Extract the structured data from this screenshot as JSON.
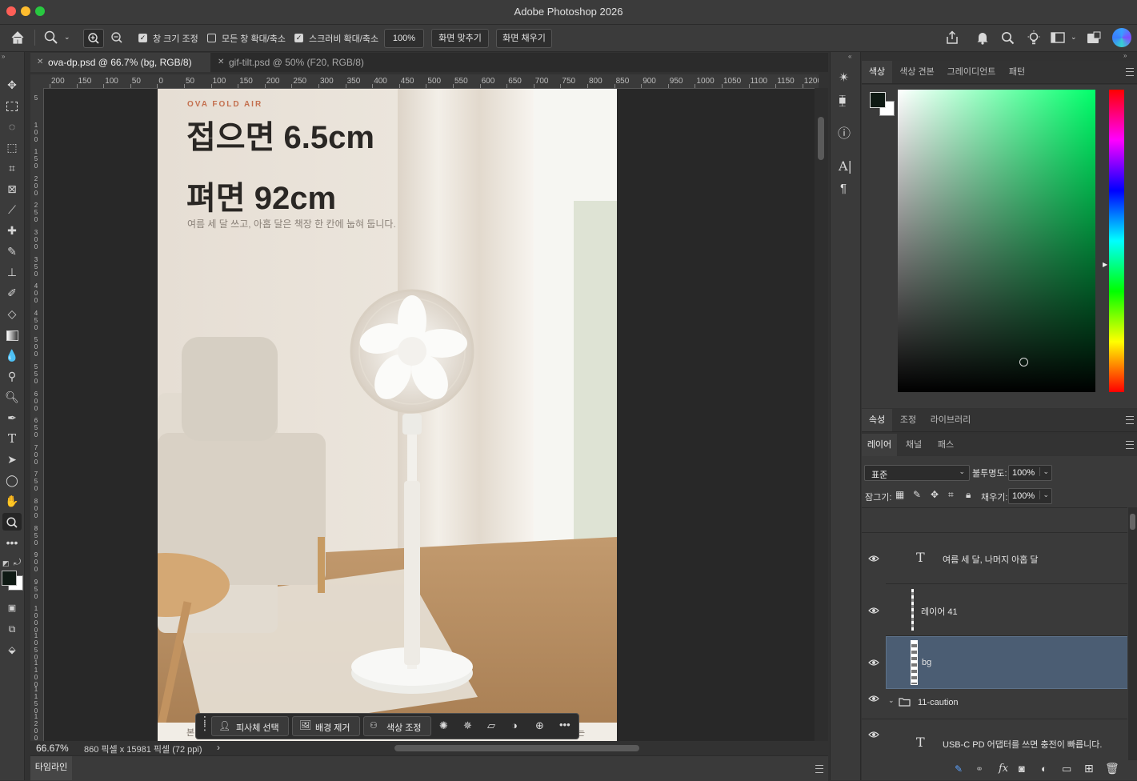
{
  "app": {
    "title": "Adobe Photoshop 2026"
  },
  "options": {
    "resize_windows": "창 크기 조정",
    "zoom_all_windows": "모든 창 확대/축소",
    "scrubby_zoom": "스크러비 확대/축소",
    "zoom_value": "100%",
    "fit_screen": "화면 맞추기",
    "fill_screen": "화면 채우기"
  },
  "tabs": [
    {
      "label": "ova-dp.psd @ 66.7% (bg, RGB/8)",
      "active": true
    },
    {
      "label": "gif-tilt.psd @ 50% (F20, RGB/8)",
      "active": false
    }
  ],
  "ruler": {
    "top": [
      "200",
      "150",
      "100",
      "50",
      "0",
      "50",
      "100",
      "150",
      "200",
      "250",
      "300",
      "350",
      "400",
      "450",
      "500",
      "550",
      "600",
      "650",
      "700",
      "750",
      "800",
      "850",
      "900",
      "950",
      "1000",
      "1050",
      "1100",
      "1150",
      "1200"
    ],
    "left": [
      "5",
      "100",
      "150",
      "200",
      "250",
      "300",
      "350",
      "400",
      "450",
      "500",
      "550",
      "600",
      "650",
      "700",
      "750",
      "800",
      "850",
      "900",
      "950",
      "1000",
      "1050",
      "1100",
      "1150",
      "1200"
    ]
  },
  "document": {
    "brand": "OVA FOLD AIR",
    "headline1": "접으면 6.5cm",
    "headline2": "펴면 92cm",
    "subtitle": "여름 세 달 쓰고, 아홉 달은 책장 한 칸에 눕혀 둡니다.",
    "bottom_left": "본",
    "bottom_right": "는"
  },
  "taskbar": {
    "select_subject": "피사체 선택",
    "remove_bg": "배경 제거",
    "color_adjust": "색상 조정"
  },
  "status": {
    "zoom": "66.67%",
    "doc_info": "860 픽셀 x 15981 픽셀 (72 ppi)",
    "arrow": "›"
  },
  "timeline": {
    "label": "타임라인"
  },
  "color_panel": {
    "tabs": [
      "색상",
      "색상 견본",
      "그레이디언트",
      "패턴"
    ],
    "foreground": "#0f1a14",
    "background": "#ffffff",
    "hue": "#00ff6a"
  },
  "props_panel": {
    "tabs": [
      "속성",
      "조정",
      "라이브러리"
    ]
  },
  "layers_panel": {
    "tabs": [
      "레이어",
      "채널",
      "패스"
    ],
    "blend_mode": "표준",
    "opacity_label": "불투명도:",
    "opacity_value": "100%",
    "lock_label": "잠그기:",
    "fill_label": "채우기:",
    "fill_value": "100%",
    "layers": [
      {
        "name": "여름 세 달, 나머지 아홉 달",
        "type": "text"
      },
      {
        "name": "레이어 41",
        "type": "pixel"
      },
      {
        "name": "bg",
        "type": "pixel",
        "selected": true
      },
      {
        "name": "11-caution",
        "type": "group"
      },
      {
        "name": "USB-C PD 어댑터를 쓰면 충전이 빠릅니다.",
        "type": "text"
      }
    ],
    "glyph_text": "T",
    "fx": "fx"
  },
  "icons": {
    "home": "home-icon",
    "zoom": "zoom-icon",
    "share": "share-icon",
    "bell": "bell-icon",
    "search": "search-icon",
    "bulb": "lightbulb-icon",
    "workspace": "workspace-icon",
    "eye": "eye-icon"
  }
}
